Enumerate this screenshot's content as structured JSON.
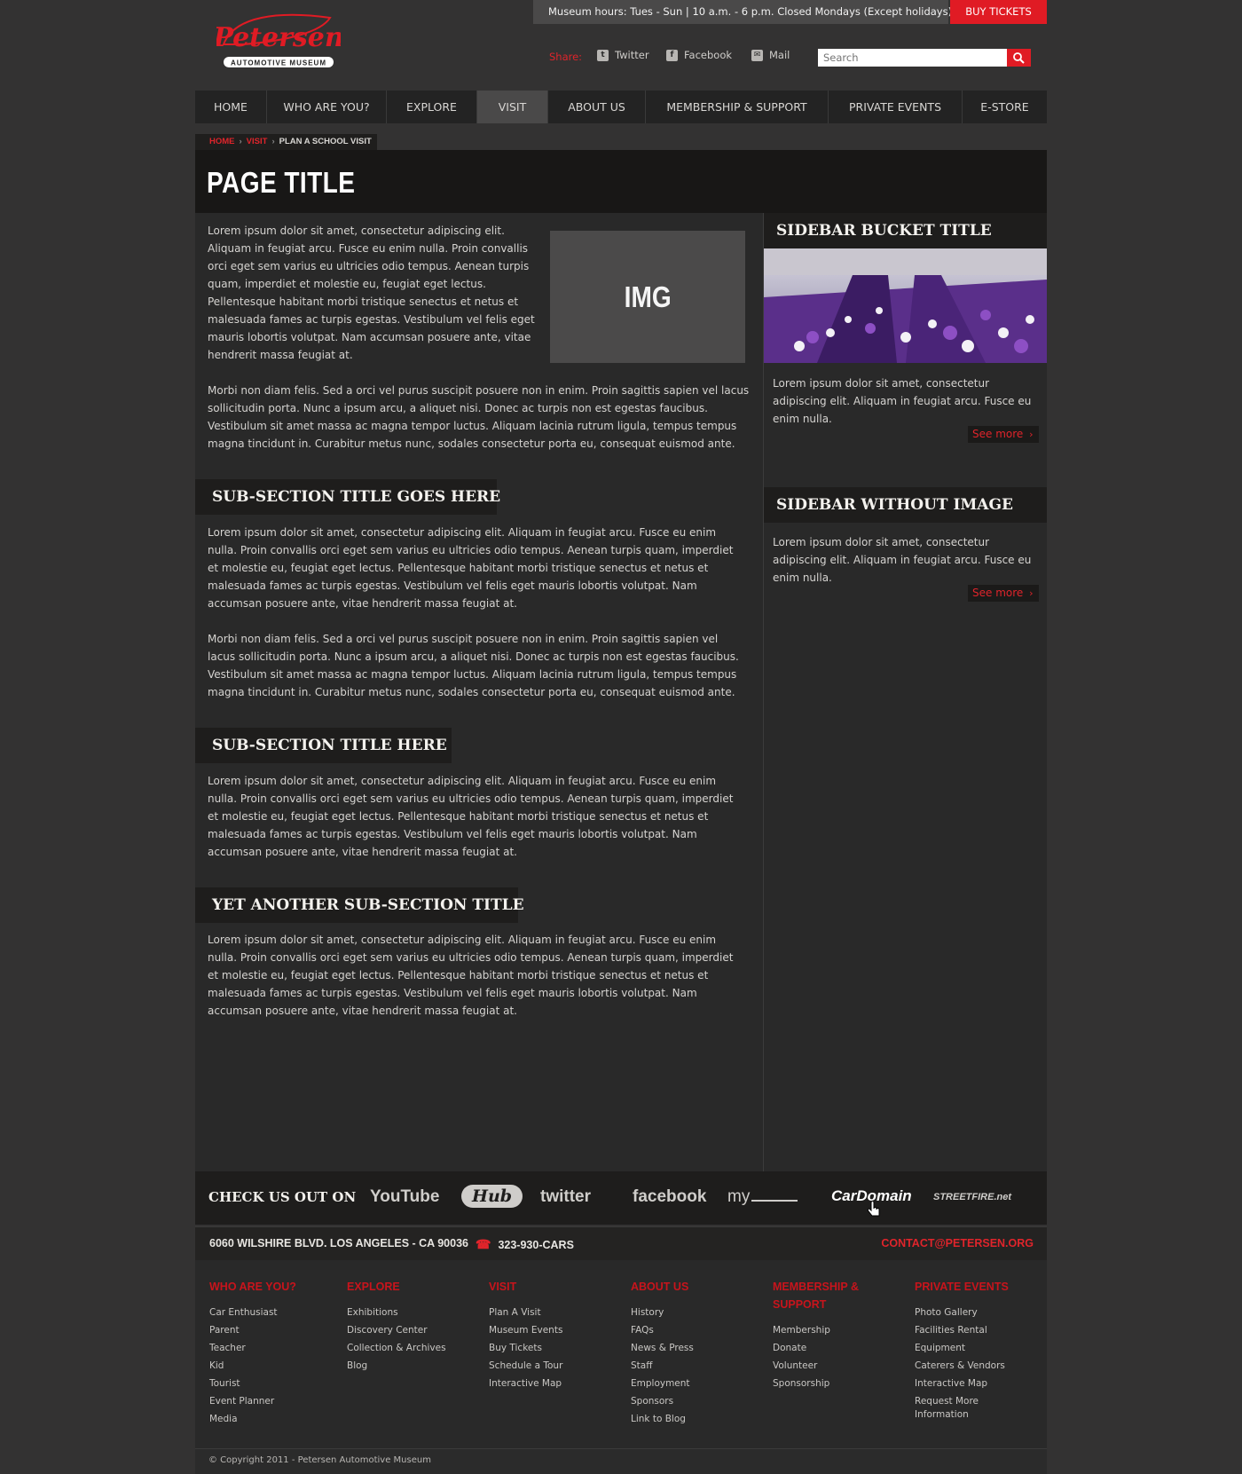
{
  "header": {
    "logo_text": "Petersen",
    "logo_sub": "AUTOMOTIVE MUSEUM",
    "hours": "Museum hours: Tues - Sun | 10 a.m. - 6 p.m. Closed Mondays (Except holidays)",
    "buy_tickets": "BUY TICKETS",
    "share_label": "Share:",
    "share": [
      {
        "label": "Twitter",
        "icon": "twitter-icon"
      },
      {
        "label": "Facebook",
        "icon": "facebook-icon"
      },
      {
        "label": "Mail",
        "icon": "mail-icon"
      }
    ],
    "search_placeholder": "Search"
  },
  "nav": [
    {
      "label": "HOME"
    },
    {
      "label": "WHO ARE YOU?"
    },
    {
      "label": "EXPLORE"
    },
    {
      "label": "VISIT",
      "active": true
    },
    {
      "label": "ABOUT US"
    },
    {
      "label": "MEMBERSHIP & SUPPORT"
    },
    {
      "label": "PRIVATE EVENTS"
    },
    {
      "label": "E-STORE"
    }
  ],
  "breadcrumb": {
    "home": "HOME",
    "visit": "VISIT",
    "current": "PLAN A SCHOOL VISIT"
  },
  "page_title": "PAGE TITLE",
  "content": {
    "intro": "Lorem ipsum dolor sit amet, consectetur adipiscing elit. Aliquam in feugiat arcu. Fusce eu enim nulla. Proin convallis orci eget sem varius eu ultricies odio tempus. Aenean turpis quam, imperdiet et molestie eu, feugiat eget lectus. Pellentesque habitant morbi tristique senectus et netus et malesuada fames ac turpis egestas. Vestibulum vel felis eget mauris lobortis volutpat. Nam accumsan posuere ante, vitae hendrerit massa feugiat at.",
    "img_label": "IMG",
    "para2": "Morbi non diam felis. Sed a orci vel purus suscipit posuere non in enim. Proin sagittis sapien vel lacus sollicitudin porta. Nunc a ipsum arcu, a aliquet nisi. Donec ac turpis non est egestas faucibus. Vestibulum sit amet massa ac magna tempor luctus. Aliquam lacinia rutrum ligula, tempus tempus magna tincidunt in. Curabitur metus nunc, sodales consectetur porta eu, consequat euismod ante.",
    "sub1_title": "SUB-SECTION TITLE GOES HERE",
    "sub1_p1": "Lorem ipsum dolor sit amet, consectetur adipiscing elit. Aliquam in feugiat arcu. Fusce eu enim nulla. Proin convallis orci eget sem varius eu ultricies odio tempus. Aenean turpis quam, imperdiet et molestie eu, feugiat eget lectus. Pellentesque habitant morbi tristique senectus et netus et malesuada fames ac turpis egestas. Vestibulum vel felis eget mauris lobortis volutpat. Nam accumsan posuere ante, vitae hendrerit massa feugiat at.",
    "sub1_p2": "Morbi non diam felis. Sed a orci vel purus suscipit posuere non in enim. Proin sagittis sapien vel lacus sollicitudin porta. Nunc a ipsum arcu, a aliquet nisi. Donec ac turpis non est egestas faucibus. Vestibulum sit amet massa ac magna tempor luctus. Aliquam lacinia rutrum ligula, tempus tempus magna tincidunt in. Curabitur metus nunc, sodales consectetur porta eu, consequat euismod ante.",
    "sub2_title": "SUB-SECTION TITLE HERE",
    "sub2_p1": "Lorem ipsum dolor sit amet, consectetur adipiscing elit. Aliquam in feugiat arcu. Fusce eu enim nulla. Proin convallis orci eget sem varius eu ultricies odio tempus. Aenean turpis quam, imperdiet et molestie eu, feugiat eget lectus. Pellentesque habitant morbi tristique senectus et netus et malesuada fames ac turpis egestas. Vestibulum vel felis eget mauris lobortis volutpat. Nam accumsan posuere ante, vitae hendrerit massa feugiat at.",
    "sub3_title": "YET ANOTHER SUB-SECTION TITLE",
    "sub3_p1": "Lorem ipsum dolor sit amet, consectetur adipiscing elit. Aliquam in feugiat arcu. Fusce eu enim nulla. Proin convallis orci eget sem varius eu ultricies odio tempus. Aenean turpis quam, imperdiet et molestie eu, feugiat eget lectus. Pellentesque habitant morbi tristique senectus et netus et malesuada fames ac turpis egestas. Vestibulum vel felis eget mauris lobortis volutpat. Nam accumsan posuere ante, vitae hendrerit massa feugiat at."
  },
  "sidebar": {
    "bucket1_title": "SIDEBAR BUCKET TITLE",
    "bucket1_text": "Lorem ipsum dolor sit amet, consectetur adipiscing elit. Aliquam in feugiat arcu. Fusce eu enim nulla.",
    "bucket2_title": "SIDEBAR WITHOUT IMAGE",
    "bucket2_text": "Lorem ipsum dolor sit amet, consectetur adipiscing elit. Aliquam in feugiat arcu. Fusce eu enim nulla.",
    "see_more": "See more"
  },
  "footer": {
    "check_title": "CHECK US OUT ON",
    "brands": [
      "YouTube",
      "Hub",
      "twitter",
      "facebook",
      "my",
      "CarDomain",
      "STREETFIRE.net"
    ],
    "address": "6060 WILSHIRE BLVD. LOS ANGELES - CA 90036",
    "phone": "323-930-CARS",
    "contact": "CONTACT@PETERSEN.ORG",
    "columns": [
      {
        "title": "WHO ARE YOU?",
        "links": [
          "Car Enthusiast",
          "Parent",
          "Teacher",
          "Kid",
          "Tourist",
          "Event Planner",
          "Media"
        ]
      },
      {
        "title": "EXPLORE",
        "links": [
          "Exhibitions",
          "Discovery Center",
          "Collection & Archives",
          "Blog"
        ]
      },
      {
        "title": "VISIT",
        "links": [
          "Plan A Visit",
          "Museum Events",
          "Buy Tickets",
          "Schedule a Tour",
          "Interactive Map"
        ]
      },
      {
        "title": "ABOUT US",
        "links": [
          "History",
          "FAQs",
          "News & Press",
          "Staff",
          "Employment",
          "Sponsors",
          "Link to Blog"
        ]
      },
      {
        "title": "MEMBERSHIP & SUPPORT",
        "links": [
          "Membership",
          "Donate",
          "Volunteer",
          "Sponsorship"
        ]
      },
      {
        "title": "PRIVATE EVENTS",
        "links": [
          "Photo Gallery",
          "Facilities Rental",
          "Equipment",
          "Caterers & Vendors",
          "Interactive Map",
          "Request More Information"
        ]
      }
    ],
    "copyright": "© Copyright 2011 - Petersen Automotive Museum"
  }
}
